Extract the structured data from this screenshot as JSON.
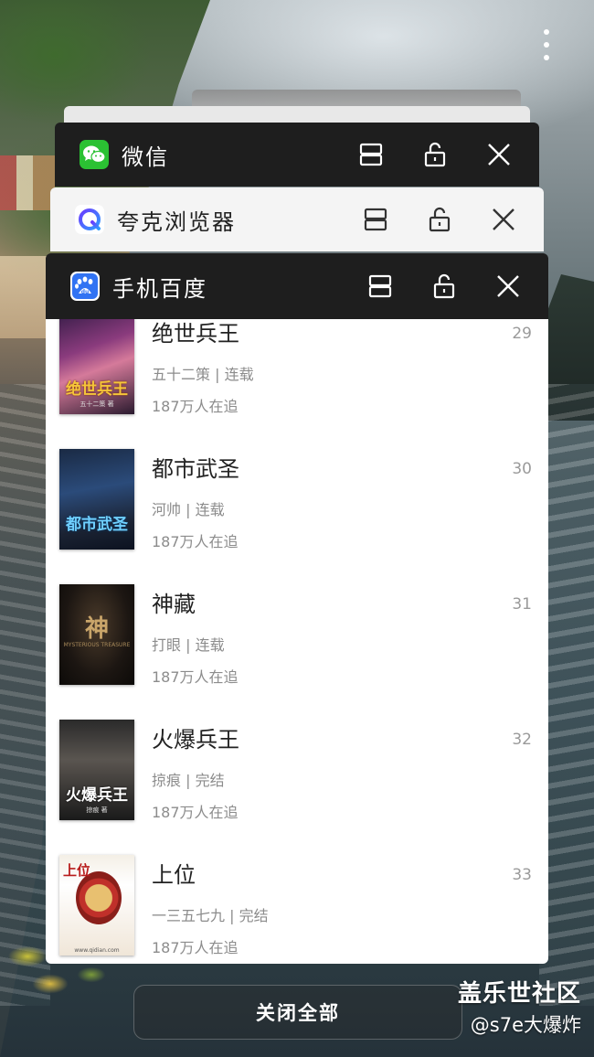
{
  "overview": {
    "close_all_label": "关闭全部",
    "more_menu_icon": "more-vertical-icon"
  },
  "apps": [
    {
      "name": "微信",
      "icon": "wechat-icon",
      "icon_color": "#2bc133",
      "header_color": "#1e1e1e",
      "controls": [
        "split-screen-icon",
        "unlock-icon",
        "close-icon"
      ]
    },
    {
      "name": "夸克浏览器",
      "icon": "quark-browser-icon",
      "icon_color": "#4b5cff",
      "header_color": "#f4f4f4",
      "controls": [
        "split-screen-icon",
        "unlock-icon",
        "close-icon"
      ]
    },
    {
      "name": "手机百度",
      "icon": "baidu-icon",
      "icon_color": "#3173f3",
      "header_color": "#1e1e1e",
      "controls": [
        "split-screen-icon",
        "unlock-icon",
        "close-icon"
      ]
    }
  ],
  "baidu_list": {
    "books": [
      {
        "title": "绝世兵王",
        "meta": "五十二策 | 连载",
        "followers": "187万人在追",
        "rank": "29",
        "cover_text": "绝世兵王",
        "cover_sub": "五十二策 著"
      },
      {
        "title": "都市武圣",
        "meta": "河帅 | 连载",
        "followers": "187万人在追",
        "rank": "30",
        "cover_text": "都市武圣",
        "cover_sub": ""
      },
      {
        "title": "神藏",
        "meta": "打眼 | 连载",
        "followers": "187万人在追",
        "rank": "31",
        "cover_text": "神",
        "cover_sub": "MYSTERIOUS TREASURE"
      },
      {
        "title": "火爆兵王",
        "meta": "掠痕 | 完结",
        "followers": "187万人在追",
        "rank": "32",
        "cover_text": "火爆兵王",
        "cover_sub": "掠痕 著"
      },
      {
        "title": "上位",
        "meta": "一三五七九 | 完结",
        "followers": "187万人在追",
        "rank": "33",
        "cover_text": "上位",
        "cover_sub": "www.qidian.com"
      }
    ]
  },
  "watermark": {
    "site": "盖乐世社区",
    "user": "@s7e大爆炸"
  }
}
